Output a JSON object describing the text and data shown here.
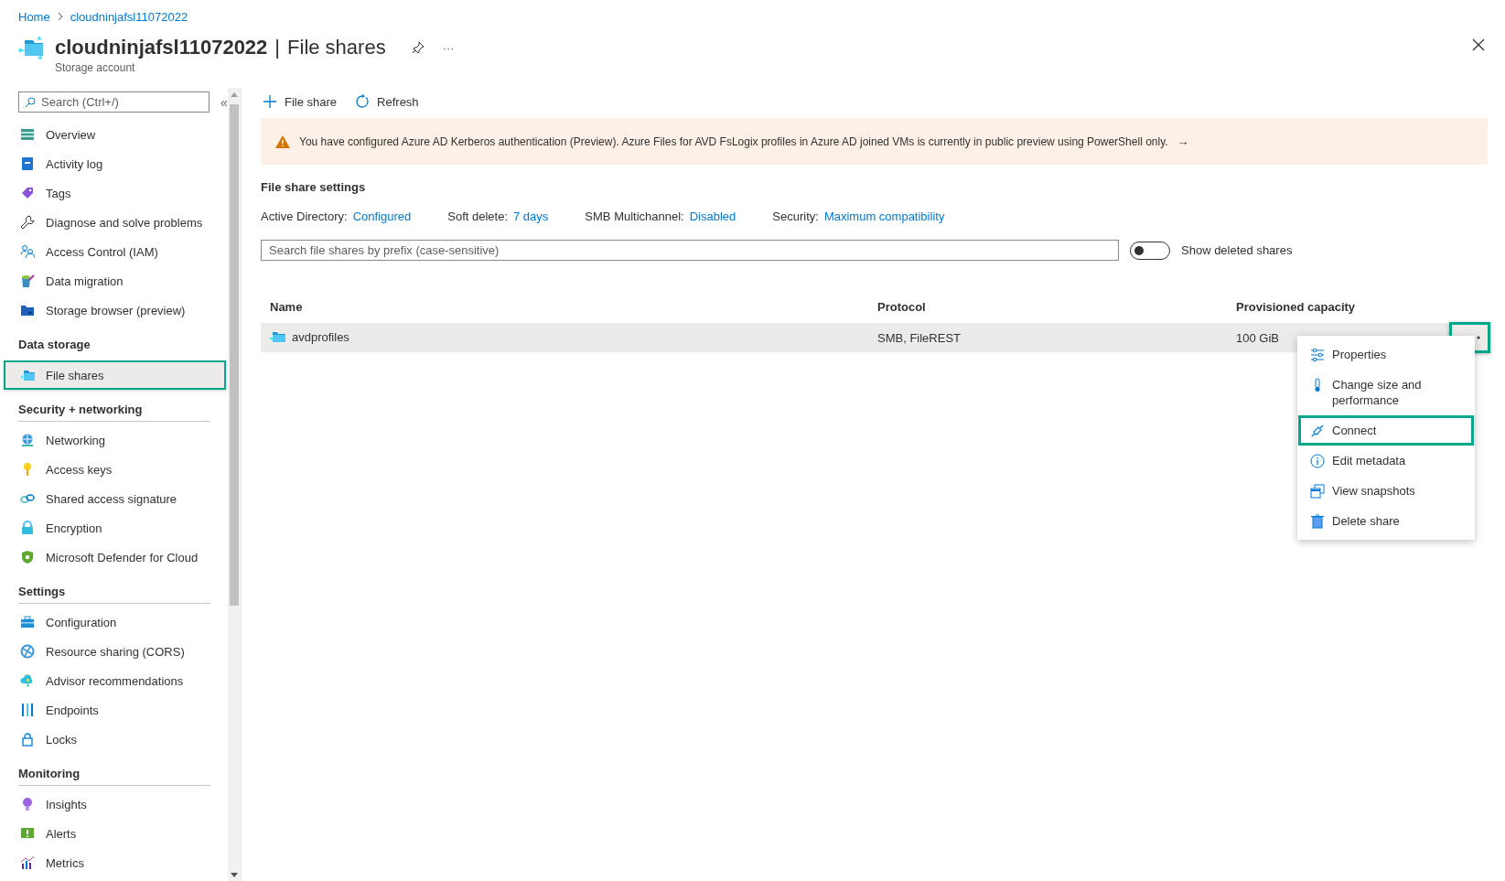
{
  "breadcrumb": [
    {
      "label": "Home"
    },
    {
      "label": "cloudninjafsl11072022"
    }
  ],
  "header": {
    "resource_name": "cloudninjafsl11072022",
    "separator": "|",
    "page_title": "File shares",
    "subtitle": "Storage account",
    "more": "···"
  },
  "sidebar": {
    "search_placeholder": "Search (Ctrl+/)",
    "collapse": "«",
    "items": [
      {
        "label": "Overview",
        "selected": false,
        "highlighted": false
      },
      {
        "label": "Activity log",
        "selected": false,
        "highlighted": false
      },
      {
        "label": "Tags",
        "selected": false,
        "highlighted": false
      },
      {
        "label": "Diagnose and solve problems",
        "selected": false,
        "highlighted": false
      },
      {
        "label": "Access Control (IAM)",
        "selected": false,
        "highlighted": false
      },
      {
        "label": "Data migration",
        "selected": false,
        "highlighted": false
      },
      {
        "label": "Storage browser (preview)",
        "selected": false,
        "highlighted": false
      }
    ],
    "sections": [
      {
        "heading": "Data storage",
        "items": [
          {
            "label": "File shares",
            "selected": true,
            "highlighted": true
          }
        ]
      },
      {
        "heading": "Security + networking",
        "items": [
          {
            "label": "Networking",
            "selected": false,
            "highlighted": false
          },
          {
            "label": "Access keys",
            "selected": false,
            "highlighted": false
          },
          {
            "label": "Shared access signature",
            "selected": false,
            "highlighted": false
          },
          {
            "label": "Encryption",
            "selected": false,
            "highlighted": false
          },
          {
            "label": "Microsoft Defender for Cloud",
            "selected": false,
            "highlighted": false
          }
        ]
      },
      {
        "heading": "Settings",
        "items": [
          {
            "label": "Configuration",
            "selected": false,
            "highlighted": false
          },
          {
            "label": "Resource sharing (CORS)",
            "selected": false,
            "highlighted": false
          },
          {
            "label": "Advisor recommendations",
            "selected": false,
            "highlighted": false
          },
          {
            "label": "Endpoints",
            "selected": false,
            "highlighted": false
          },
          {
            "label": "Locks",
            "selected": false,
            "highlighted": false
          }
        ]
      },
      {
        "heading": "Monitoring",
        "items": [
          {
            "label": "Insights",
            "selected": false,
            "highlighted": false
          },
          {
            "label": "Alerts",
            "selected": false,
            "highlighted": false
          },
          {
            "label": "Metrics",
            "selected": false,
            "highlighted": false
          }
        ]
      }
    ]
  },
  "toolbar": [
    {
      "kind": "add",
      "label": "File share"
    },
    {
      "kind": "refresh",
      "label": "Refresh"
    }
  ],
  "banner": {
    "kind": "warning",
    "text": "You have configured Azure AD Kerberos authentication (Preview). Azure Files for AVD FsLogix profiles in Azure AD joined VMs is currently in public preview using PowerShell only.",
    "arrow": "→"
  },
  "settings": {
    "title": "File share settings",
    "fields": [
      {
        "label": "Active Directory:",
        "value": "Configured"
      },
      {
        "label": "Soft delete:",
        "value": "7 days"
      },
      {
        "label": "SMB Multichannel:",
        "value": "Disabled"
      },
      {
        "label": "Security:",
        "value": "Maximum compatibility"
      }
    ]
  },
  "filter": {
    "placeholder": "Search file shares by prefix (case-sensitive)"
  },
  "show_deleted": {
    "label": "Show deleted shares",
    "on": false
  },
  "table": {
    "columns": [
      "Name",
      "Protocol",
      "Provisioned capacity"
    ],
    "rows": [
      {
        "cells": [
          "avdprofiles",
          "SMB, FileREST",
          "100 GiB"
        ],
        "selected": true,
        "more_highlighted": true
      }
    ]
  },
  "context_menu": {
    "items": [
      {
        "kind": "properties",
        "label": "Properties",
        "highlighted": false
      },
      {
        "kind": "size",
        "label": "Change size and performance",
        "highlighted": false
      },
      {
        "kind": "connect",
        "label": "Connect",
        "highlighted": true
      },
      {
        "kind": "info",
        "label": "Edit metadata",
        "highlighted": false
      },
      {
        "kind": "snapshots",
        "label": "View snapshots",
        "highlighted": false
      },
      {
        "kind": "delete",
        "label": "Delete share",
        "highlighted": false
      }
    ]
  }
}
